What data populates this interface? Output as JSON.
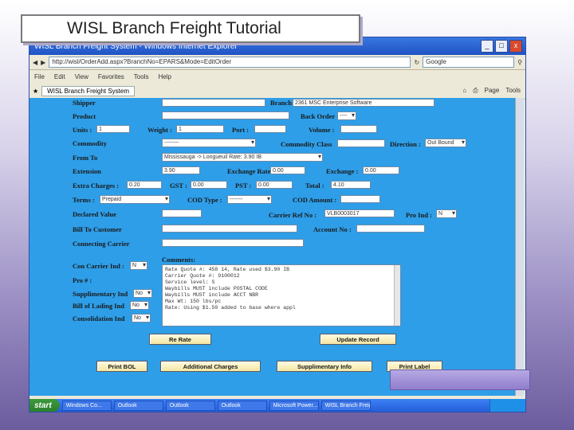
{
  "slide": {
    "title": "WISL Branch Freight Tutorial"
  },
  "window": {
    "title": "WISL Branch Freight System - Windows Internet Explorer",
    "address": "http://wisl/OrderAdd.aspx?BranchNo=EPARS&Mode=EditOrder",
    "search_placeholder": "Google",
    "menu": [
      "File",
      "Edit",
      "View",
      "Favorites",
      "Tools",
      "Help"
    ],
    "tab": "WISL Branch Freight System",
    "tools": [
      "Page",
      "Tools"
    ],
    "controls": {
      "min": "_",
      "max": "□",
      "close": "x"
    }
  },
  "form": {
    "shipper_label": "Shipper",
    "branch_label": "Branch",
    "branch_value": "2361 MSC Enterprise Software",
    "product_label": "Product",
    "back_order_label": "Back Order",
    "back_order_value": "----",
    "units_label": "Units :",
    "units_value": "1",
    "weight_label": "Weight :",
    "weight_value": "1",
    "port_label": "Port :",
    "volume_label": "Volume :",
    "commodity_label": "Commodity",
    "commodity_value": "--------",
    "commodity_class_label": "Commodity Class",
    "direction_label": "Direction :",
    "direction_value": "Out Bound",
    "from_to_label": "From   To",
    "from_to_value": "Mississauga -> Longueuil Rate: 3.90 IB",
    "extension_label": "Extension",
    "extension_value": "3.90",
    "exchange_rate_label": "Exchange Rate:",
    "exchange_rate_value": "0.00",
    "exchange_label": "Exchange :",
    "exchange_value": "0.00",
    "extra_charges_label": "Extra Charges :",
    "extra_charges_value": "0.20",
    "gst_label": "GST :",
    "gst_value": "0.00",
    "pst_label": "PST :",
    "pst_value": "0.00",
    "total_label": "Total :",
    "total_value": "4.10",
    "terms_label": "Terms :",
    "terms_value": "Prepaid",
    "cod_type_label": "COD Type :",
    "cod_type_value": "-------",
    "cod_amount_label": "COD Amount :",
    "declared_value_label": "Declared Value",
    "carrier_ref_label": "Carrier Ref No :",
    "carrier_ref_value": "VLB0003017",
    "pro_ind_label": "Pro Ind :",
    "pro_ind_value": "N",
    "bill_to_customer_label": "Bill To Customer",
    "account_no_label": "Account No :",
    "connecting_carrier_label": "Connecting Carrier",
    "con_carrier_ind_label": "Con Carrier Ind :",
    "con_carrier_ind_value": "N",
    "comments_label": "Comments:",
    "pro_no_label": "Pro # :",
    "supplimentary_ind_label": "Supplimentary Ind",
    "supplimentary_ind_value": "No",
    "bill_of_lading_ind_label": "Bill of Lading Ind",
    "bill_of_lading_ind_value": "No",
    "consolidation_ind_label": "Consolidation Ind",
    "consolidation_ind_value": "No",
    "comments_lines": [
      "Rate Quote #: 458 14, Rate used $3.90 IB",
      "",
      "Carrier Quote #: 9100012",
      "Service level: S",
      "Waybills MUST include POSTAL CODE",
      "Waybills MUST include ACCT NBR",
      "Max Wt: 150 lbs/pc",
      "Rate: Using $1.50 added to base where appl"
    ]
  },
  "buttons": {
    "rate": "Re Rate",
    "update": "Update Record",
    "print_bol": "Print BOL",
    "additional_charges": "Additional Charges",
    "supplimentary_info": "Supplimentary Info",
    "print_label": "Print Label"
  },
  "taskbar": {
    "start": "start",
    "tasks": [
      "Windows Co...",
      "Outlook",
      "Outlook",
      "Outlook",
      "Microsoft Power...",
      "WISL Branch Freig..."
    ]
  }
}
